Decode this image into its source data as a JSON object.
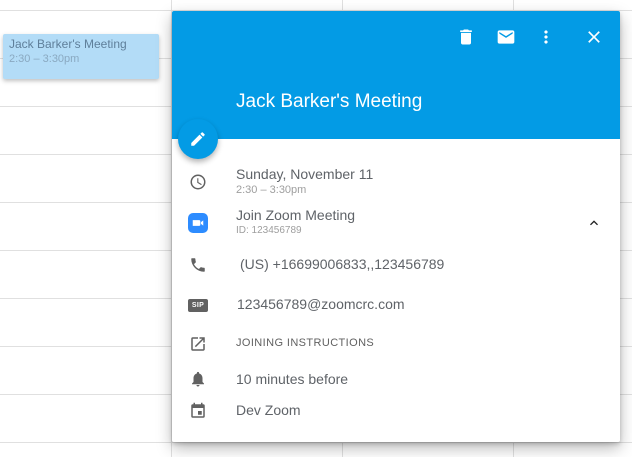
{
  "event_chip": {
    "title": "Jack Barker's Meeting",
    "time": "2:30 – 3:30pm"
  },
  "card": {
    "title": "Jack Barker's Meeting",
    "header_color": "#039be5",
    "actions": [
      "delete-icon",
      "email-icon",
      "more-vert-icon",
      "close-icon"
    ],
    "date": "Sunday, November 11",
    "time": "2:30 – 3:30pm",
    "zoom": {
      "label": "Join Zoom Meeting",
      "id": "ID: 123456789",
      "brand_color": "#2d8cff"
    },
    "phone": "(US) +16699006833,,123456789",
    "sip": {
      "badge": "SIP",
      "address": "123456789@zoomcrc.com"
    },
    "joining_instructions": "JOINING INSTRUCTIONS",
    "reminder": "10 minutes before",
    "calendar": "Dev Zoom"
  }
}
